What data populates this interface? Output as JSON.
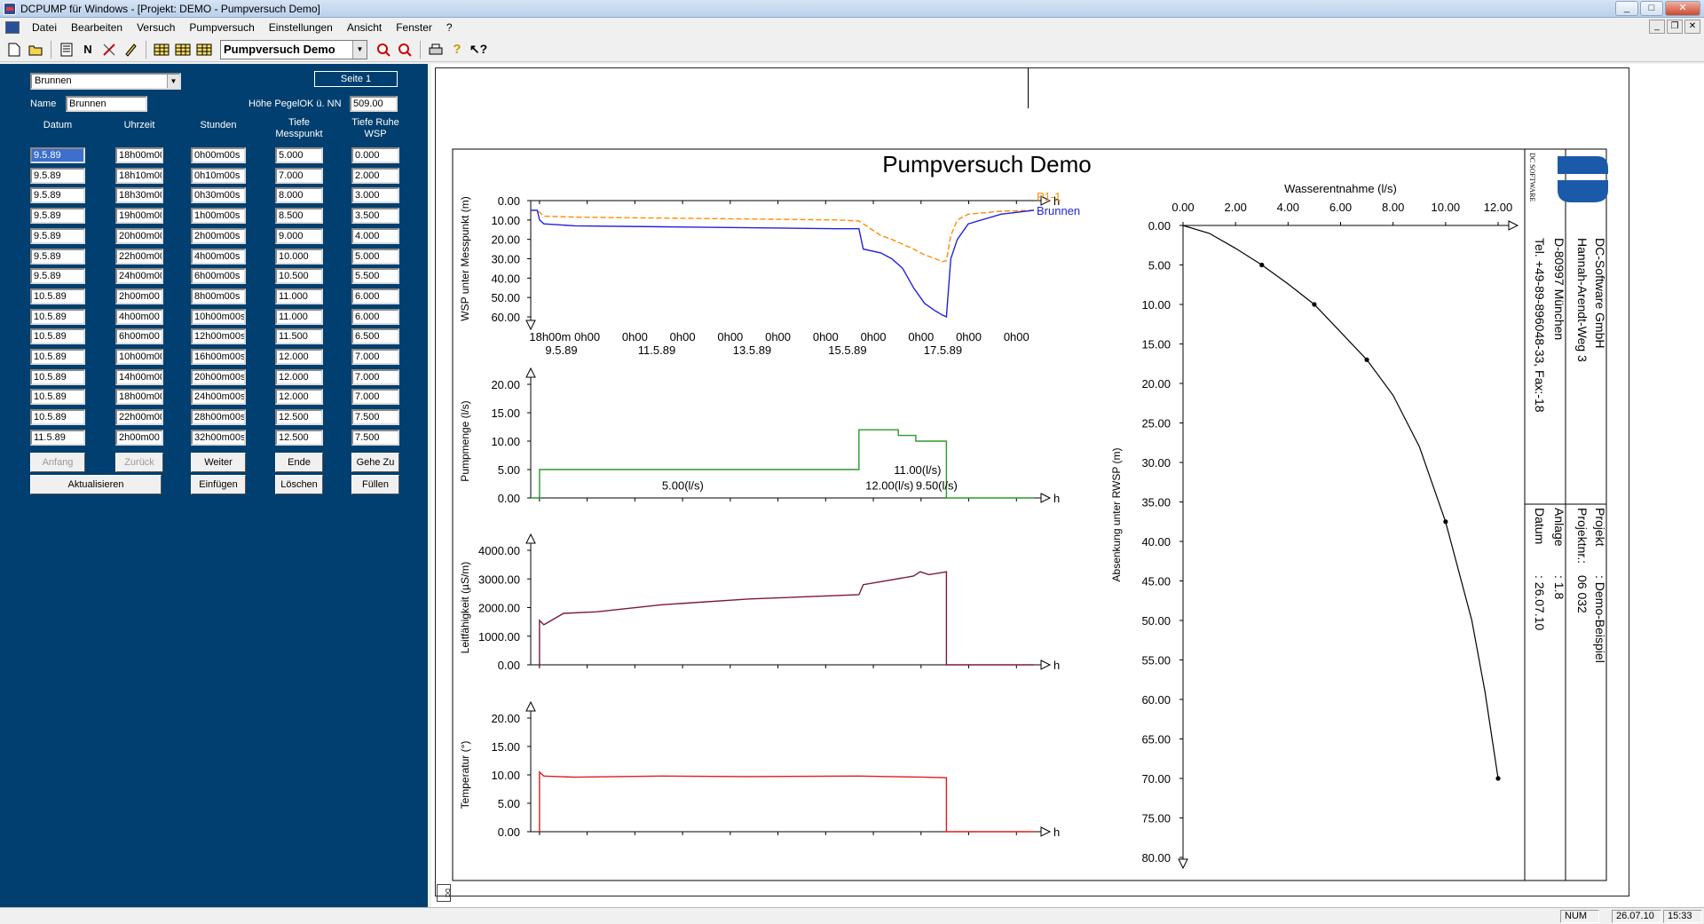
{
  "window": {
    "title": "DCPUMP für Windows - [Projekt: DEMO - Pumpversuch Demo]",
    "min": "_",
    "max": "□",
    "close": "✕"
  },
  "menu": [
    "Datei",
    "Bearbeiten",
    "Versuch",
    "Pumpversuch",
    "Einstellungen",
    "Ansicht",
    "Fenster",
    "?"
  ],
  "toolbar": {
    "project_select": "Pumpversuch Demo",
    "icons": [
      "new-icon",
      "open-icon",
      "doc-icon",
      "N",
      "cut-line-icon",
      "pen-icon",
      "table-icon",
      "table-icon",
      "table-icon",
      "zoom-in-icon",
      "zoom-out-icon",
      "print-icon",
      "help-icon",
      "context-help-icon"
    ]
  },
  "left_panel": {
    "well_select": "Brunnen",
    "page_label": "Seite 1",
    "name_label": "Name",
    "name_value": "Brunnen",
    "height_label": "Höhe PegelOK ü. NN",
    "height_value": "509.00",
    "columns": [
      "Datum",
      "Uhrzeit",
      "Stunden",
      "Tiefe Messpunkt",
      "Tiefe Ruhe WSP"
    ],
    "rows": [
      [
        "9.5.89",
        "18h00m00",
        "0h00m00s",
        "5.000",
        "0.000"
      ],
      [
        "9.5.89",
        "18h10m00",
        "0h10m00s",
        "7.000",
        "2.000"
      ],
      [
        "9.5.89",
        "18h30m00",
        "0h30m00s",
        "8.000",
        "3.000"
      ],
      [
        "9.5.89",
        "19h00m00",
        "1h00m00s",
        "8.500",
        "3.500"
      ],
      [
        "9.5.89",
        "20h00m00",
        "2h00m00s",
        "9.000",
        "4.000"
      ],
      [
        "9.5.89",
        "22h00m00",
        "4h00m00s",
        "10.000",
        "5.000"
      ],
      [
        "9.5.89",
        "24h00m00",
        "6h00m00s",
        "10.500",
        "5.500"
      ],
      [
        "10.5.89",
        "2h00m00",
        "8h00m00s",
        "11.000",
        "6.000"
      ],
      [
        "10.5.89",
        "4h00m00",
        "10h00m00s",
        "11.000",
        "6.000"
      ],
      [
        "10.5.89",
        "6h00m00",
        "12h00m00s",
        "11.500",
        "6.500"
      ],
      [
        "10.5.89",
        "10h00m00",
        "16h00m00s",
        "12.000",
        "7.000"
      ],
      [
        "10.5.89",
        "14h00m00",
        "20h00m00s",
        "12.000",
        "7.000"
      ],
      [
        "10.5.89",
        "18h00m00",
        "24h00m00s",
        "12.000",
        "7.000"
      ],
      [
        "10.5.89",
        "22h00m00",
        "28h00m00s",
        "12.500",
        "7.500"
      ],
      [
        "11.5.89",
        "2h00m00",
        "32h00m00s",
        "12.500",
        "7.500"
      ]
    ],
    "buttons_row1": [
      "Anfang",
      "Zurück",
      "Weiter",
      "Ende",
      "Gehe Zu"
    ],
    "buttons_row2": [
      "Aktualisieren",
      "Einfügen",
      "Löschen",
      "Füllen"
    ]
  },
  "report": {
    "title": "Pumpversuch Demo",
    "company": {
      "name": "DC-Software GmbH",
      "street": "Hannah-Arendt-Weg 3",
      "city": "D-80997 München",
      "phone": "Tel. +49-89-896048-33, Fax:-18",
      "logo_small": "DC SOFTWARE"
    },
    "project_info": [
      {
        "label": "Projekt",
        "value": ": Demo-Beispiel"
      },
      {
        "label": "Projektnr.:",
        "value": "06 032"
      },
      {
        "label": "Anlage",
        "value": ": 1.8"
      },
      {
        "label": "Datum",
        "value": ": 26.07.10"
      }
    ],
    "hour_unit": "h"
  },
  "chart_data": [
    {
      "type": "line",
      "ylabel": "WSP unter Messpunkt (m)",
      "yticks": [
        "0.00",
        "10.00",
        "20.00",
        "30.00",
        "40.00",
        "50.00",
        "60.00"
      ],
      "ylim": [
        0,
        60
      ],
      "inverted_y": true,
      "xticks_top": [
        "18h00m",
        "0h00",
        "0h00",
        "0h00",
        "0h00",
        "0h00",
        "0h00",
        "0h00",
        "0h00",
        "0h00",
        "0h00"
      ],
      "xticks_bottom": [
        "9.5.89",
        "11.5.89",
        "13.5.89",
        "15.5.89",
        "17.5.89"
      ],
      "series": [
        {
          "name": "P1-1",
          "color": "#ff8c00",
          "dashed": true,
          "x": [
            0,
            3,
            4,
            6,
            20,
            60,
            100,
            140,
            150,
            160,
            165,
            175,
            180,
            185,
            188,
            190,
            192,
            195,
            200,
            215,
            230
          ],
          "y": [
            5,
            5,
            6,
            8,
            8.5,
            9,
            9.5,
            10,
            10.5,
            18,
            20,
            25,
            28,
            30,
            31.5,
            31,
            18,
            10,
            7,
            5.5,
            5
          ]
        },
        {
          "name": "Brunnen",
          "color": "#2222dd",
          "dashed": false,
          "x": [
            0,
            3,
            4,
            6,
            20,
            60,
            100,
            140,
            150,
            152,
            160,
            165,
            170,
            175,
            180,
            185,
            188,
            190,
            192,
            195,
            200,
            215,
            230
          ],
          "y": [
            5,
            5,
            10,
            12,
            13,
            13.5,
            14,
            14.5,
            14.5,
            25,
            27,
            30,
            35,
            45,
            53,
            57,
            59,
            60,
            30,
            20,
            12,
            7,
            5
          ]
        }
      ]
    },
    {
      "type": "line",
      "ylabel": "Pumpmenge (l/s)",
      "yticks": [
        "0.00",
        "5.00",
        "10.00",
        "15.00",
        "20.00"
      ],
      "ylim": [
        0,
        20
      ],
      "series": [
        {
          "name": "Pumpmenge",
          "color": "#2b9a2b",
          "x": [
            0,
            4,
            4,
            150,
            150,
            168,
            168,
            176,
            176,
            190,
            190,
            230
          ],
          "y": [
            0,
            0,
            5,
            5,
            12,
            12,
            11,
            11,
            10,
            10,
            0,
            0
          ]
        }
      ],
      "annotations": [
        {
          "text": "5.00(l/s)",
          "x": 60,
          "y": 1.5
        },
        {
          "text": "12.00(l/s)",
          "x": 153,
          "y": 1.5
        },
        {
          "text": "11.00(l/s)",
          "x": 166,
          "y": 4.2
        },
        {
          "text": "9.50(l/s)",
          "x": 176,
          "y": 1.5
        }
      ]
    },
    {
      "type": "line",
      "ylabel": "Leitfähigkeit (µS/m)",
      "yticks": [
        "0.00",
        "1000.00",
        "2000.00",
        "3000.00",
        "4000.00"
      ],
      "ylim": [
        0,
        4000
      ],
      "series": [
        {
          "name": "Leitfähigkeit",
          "color": "#7a1a3a",
          "x": [
            4,
            4,
            6,
            15,
            30,
            60,
            100,
            150,
            152,
            175,
            178,
            182,
            190,
            190,
            230
          ],
          "y": [
            0,
            1550,
            1400,
            1800,
            1850,
            2100,
            2300,
            2450,
            2800,
            3100,
            3250,
            3150,
            3250,
            0,
            0
          ]
        }
      ]
    },
    {
      "type": "line",
      "ylabel": "Temperatur (°)",
      "yticks": [
        "0.00",
        "5.00",
        "10.00",
        "15.00",
        "20.00"
      ],
      "ylim": [
        0,
        20
      ],
      "series": [
        {
          "name": "Temperatur",
          "color": "#e21b1b",
          "x": [
            4,
            4,
            6,
            20,
            60,
            100,
            150,
            180,
            190,
            190,
            230
          ],
          "y": [
            0,
            10.5,
            9.8,
            9.6,
            9.8,
            9.7,
            9.8,
            9.6,
            9.5,
            0,
            0
          ]
        }
      ]
    },
    {
      "type": "scatter",
      "xlabel": "Wasserentnahme (l/s)",
      "ylabel": "Absenkung unter RWSP (m)",
      "xticks": [
        "0.00",
        "2.00",
        "4.00",
        "6.00",
        "8.00",
        "10.00",
        "12.00"
      ],
      "yticks": [
        "0.00",
        "5.00",
        "10.00",
        "15.00",
        "20.00",
        "25.00",
        "30.00",
        "35.00",
        "40.00",
        "45.00",
        "50.00",
        "55.00",
        "60.00",
        "65.00",
        "70.00",
        "75.00",
        "80.00"
      ],
      "xlim": [
        0,
        12
      ],
      "ylim": [
        0,
        80
      ],
      "points": [
        {
          "x": 3,
          "y": 5
        },
        {
          "x": 5,
          "y": 10
        },
        {
          "x": 7,
          "y": 17
        },
        {
          "x": 10,
          "y": 37.5
        },
        {
          "x": 12,
          "y": 70
        }
      ],
      "curve": {
        "x": [
          0,
          1,
          2,
          3,
          4,
          5,
          6,
          7,
          8,
          9,
          10,
          11,
          11.5,
          12
        ],
        "y": [
          0,
          1,
          2.9,
          5,
          7.4,
          10,
          13.5,
          17,
          21.5,
          28,
          37.5,
          50,
          59,
          70
        ]
      }
    }
  ],
  "status": {
    "num": "NUM",
    "date": "26.07.10",
    "time": "15:33"
  }
}
